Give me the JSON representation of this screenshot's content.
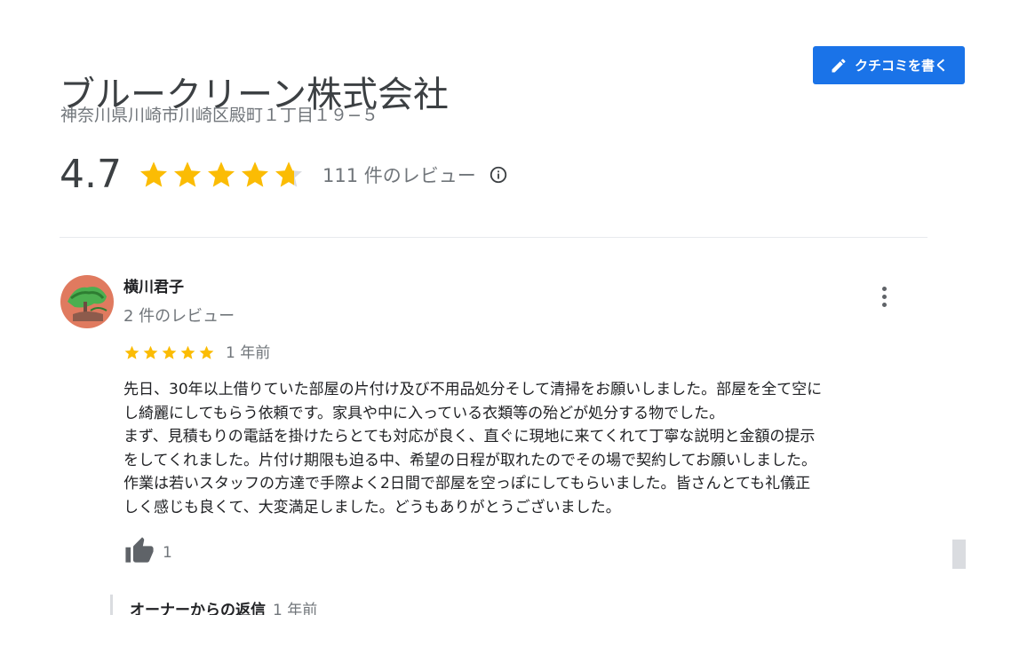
{
  "business": {
    "name": "ブルークリーン株式会社",
    "address": "神奈川県川崎市川崎区殿町１丁目１９−５",
    "rating": "4.7",
    "stars": 4.7,
    "review_count": "111 件のレビュー",
    "write_review_label": "クチコミを書く"
  },
  "colors": {
    "star": "#fbbc04",
    "star_empty": "#dadce0",
    "button": "#1a73e8"
  },
  "review": {
    "author": "横川君子",
    "author_review_count": "2 件のレビュー",
    "stars": 5,
    "date": "1 年前",
    "text_lines": [
      "先日、30年以上借りていた部屋の片付け及び不用品処分そして清掃をお願いしました。部屋を全て空に",
      "し綺麗にしてもらう依頼です。家具や中に入っている衣類等の殆どが処分する物でした。",
      "まず、見積もりの電話を掛けたらとても対応が良く、直ぐに現地に来てくれて丁寧な説明と金額の提示",
      "をしてくれました。片付け期限も迫る中、希望の日程が取れたのでその場で契約してお願いしました。",
      "作業は若いスタッフの方達で手際よく2日間で部屋を空っぽにしてもらいました。皆さんとても礼儀正",
      "しく感じも良くて、大変満足しました。どうもありがとうございました。"
    ],
    "likes": "1",
    "owner_reply_label": "オーナーからの返信",
    "owner_reply_date": "1 年前"
  }
}
